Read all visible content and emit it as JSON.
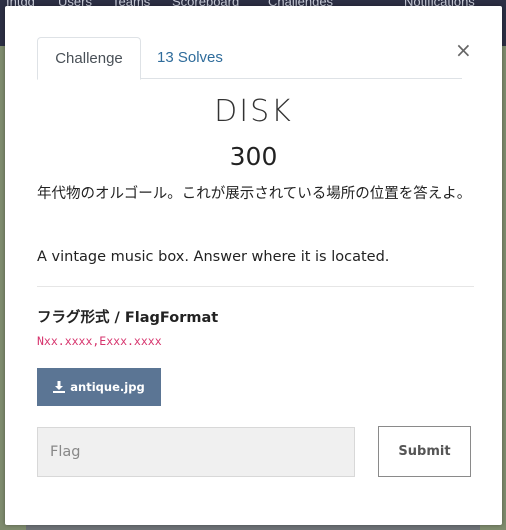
{
  "background_nav": {
    "items": [
      "Intgd",
      "Users",
      "Teams",
      "Scoreboard",
      "Challenges",
      "Notifications"
    ]
  },
  "modal": {
    "tabs": [
      {
        "label": "Challenge",
        "active": true
      },
      {
        "label": "13 Solves",
        "active": false
      }
    ],
    "close_label": "×",
    "challenge": {
      "name": "DISK",
      "value": "300",
      "description_jp": "年代物のオルゴール。これが展示されている場所の位置を答えよ。",
      "description_en": "A vintage music box. Answer where it is located.",
      "flag_format_heading": "フラグ形式 / FlagFormat",
      "flag_format": "Nxx.xxxx,Exxx.xxxx"
    },
    "file": {
      "label": "antique.jpg",
      "icon": "download-icon"
    },
    "flag_input": {
      "placeholder": "Flag",
      "value": ""
    },
    "submit_label": "Submit"
  },
  "colors": {
    "tab_link": "#2f6c9b",
    "file_button": "#5b7594",
    "flag_format_code": "#d6336c",
    "overlay_nav": "#2c2f44"
  }
}
